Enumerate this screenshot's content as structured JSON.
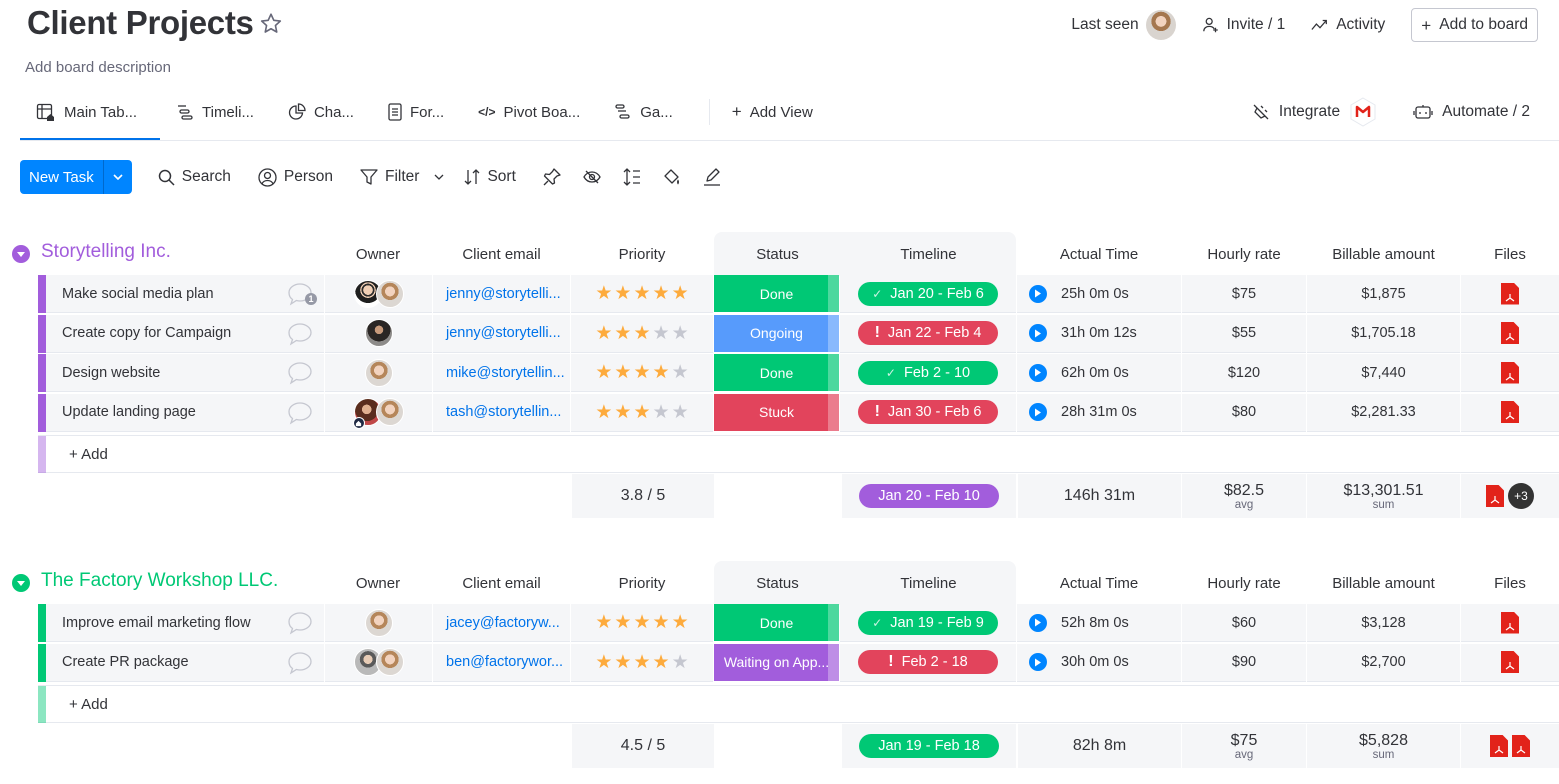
{
  "header": {
    "title": "Client Projects",
    "description": "Add board description",
    "last_seen_label": "Last seen",
    "invite_label": "Invite / 1",
    "activity_label": "Activity",
    "add_to_board_label": "Add to board"
  },
  "tabs": [
    {
      "label": "Main Tab...",
      "icon": "table-home-icon",
      "active": true
    },
    {
      "label": "Timeli...",
      "icon": "timeline-icon"
    },
    {
      "label": "Cha...",
      "icon": "chart-icon"
    },
    {
      "label": "For...",
      "icon": "form-icon"
    },
    {
      "label": "Pivot Boa...",
      "icon": "code-icon"
    },
    {
      "label": "Ga...",
      "icon": "gantt-icon"
    }
  ],
  "add_view_label": "Add View",
  "integrate_label": "Integrate",
  "automate_label": "Automate / 2",
  "toolbar": {
    "new_task_label": "New Task",
    "search_label": "Search",
    "person_label": "Person",
    "filter_label": "Filter",
    "sort_label": "Sort"
  },
  "columns": {
    "owner": "Owner",
    "email": "Client email",
    "priority": "Priority",
    "status": "Status",
    "timeline": "Timeline",
    "actual_time": "Actual Time",
    "hourly_rate": "Hourly rate",
    "billable": "Billable amount",
    "files": "Files"
  },
  "colors": {
    "group1": "#a25ddc",
    "group2": "#00c875",
    "done": "#00c875",
    "ongoing": "#579bfc",
    "stuck": "#e2445c",
    "waiting": "#a25ddc",
    "accent": "#0085ff"
  },
  "groups": [
    {
      "title": "Storytelling Inc.",
      "color": "#a25ddc",
      "add_label": "+ Add",
      "rows": [
        {
          "name": "Make social media plan",
          "comments": "1",
          "owners": [
            "m",
            "f"
          ],
          "email": "jenny@storytelli...",
          "priority": 5,
          "status": "Done",
          "status_color": "#00c875",
          "timeline": "Jan 20 - Feb 6",
          "timeline_state": "done",
          "timeline_color": "#00c875",
          "actual_time": "25h 0m 0s",
          "rate": "$75",
          "billable": "$1,875"
        },
        {
          "name": "Create copy for Campaign",
          "comments": "",
          "owners": [
            "d"
          ],
          "email": "jenny@storytelli...",
          "priority": 3,
          "status": "Ongoing",
          "status_color": "#579bfc",
          "timeline": "Jan 22 - Feb 4",
          "timeline_state": "overdue",
          "timeline_color": "#e2445c",
          "actual_time": "31h 0m 12s",
          "rate": "$55",
          "billable": "$1,705.18"
        },
        {
          "name": "Design website",
          "comments": "",
          "owners": [
            "f"
          ],
          "email": "mike@storytellin...",
          "priority": 4,
          "status": "Done",
          "status_color": "#00c875",
          "timeline": "Feb 2 - 10",
          "timeline_state": "done",
          "timeline_color": "#00c875",
          "actual_time": "62h 0m 0s",
          "rate": "$120",
          "billable": "$7,440"
        },
        {
          "name": "Update landing page",
          "comments": "",
          "owners": [
            "t",
            "f"
          ],
          "email": "tash@storytellin...",
          "priority": 3,
          "status": "Stuck",
          "status_color": "#e2445c",
          "timeline": "Jan 30 - Feb 6",
          "timeline_state": "overdue",
          "timeline_color": "#e2445c",
          "actual_time": "28h 31m 0s",
          "rate": "$80",
          "billable": "$2,281.33"
        }
      ],
      "summary": {
        "priority": "3.8  / 5",
        "timeline": "Jan 20 - Feb 10",
        "timeline_color": "#a25ddc",
        "actual_time": "146h 31m",
        "rate": "$82.5",
        "rate_label": "avg",
        "billable": "$13,301.51",
        "billable_label": "sum",
        "files_more": "+3"
      }
    },
    {
      "title": "The Factory Workshop LLC.",
      "color": "#00c875",
      "add_label": "+ Add",
      "rows": [
        {
          "name": "Improve email marketing flow",
          "comments": "",
          "owners": [
            "f"
          ],
          "email": "jacey@factoryw...",
          "priority": 5,
          "status": "Done",
          "status_color": "#00c875",
          "timeline": "Jan 19 - Feb 9",
          "timeline_state": "done",
          "timeline_color": "#00c875",
          "actual_time": "52h 8m 0s",
          "rate": "$60",
          "billable": "$3,128"
        },
        {
          "name": "Create PR package",
          "comments": "",
          "owners": [
            "g",
            "f"
          ],
          "email": "ben@factorywor...",
          "priority": 4,
          "status": "Waiting on App...",
          "status_color": "#a25ddc",
          "timeline": "Feb 2 - 18",
          "timeline_state": "overdue",
          "timeline_color": "#e2445c",
          "actual_time": "30h 0m 0s",
          "rate": "$90",
          "billable": "$2,700"
        }
      ],
      "summary": {
        "priority": "4.5  / 5",
        "timeline": "Jan 19 - Feb 18",
        "timeline_color": "#00c875",
        "actual_time": "82h 8m",
        "rate": "$75",
        "rate_label": "avg",
        "billable": "$5,828",
        "billable_label": "sum",
        "files_more": ""
      }
    }
  ]
}
